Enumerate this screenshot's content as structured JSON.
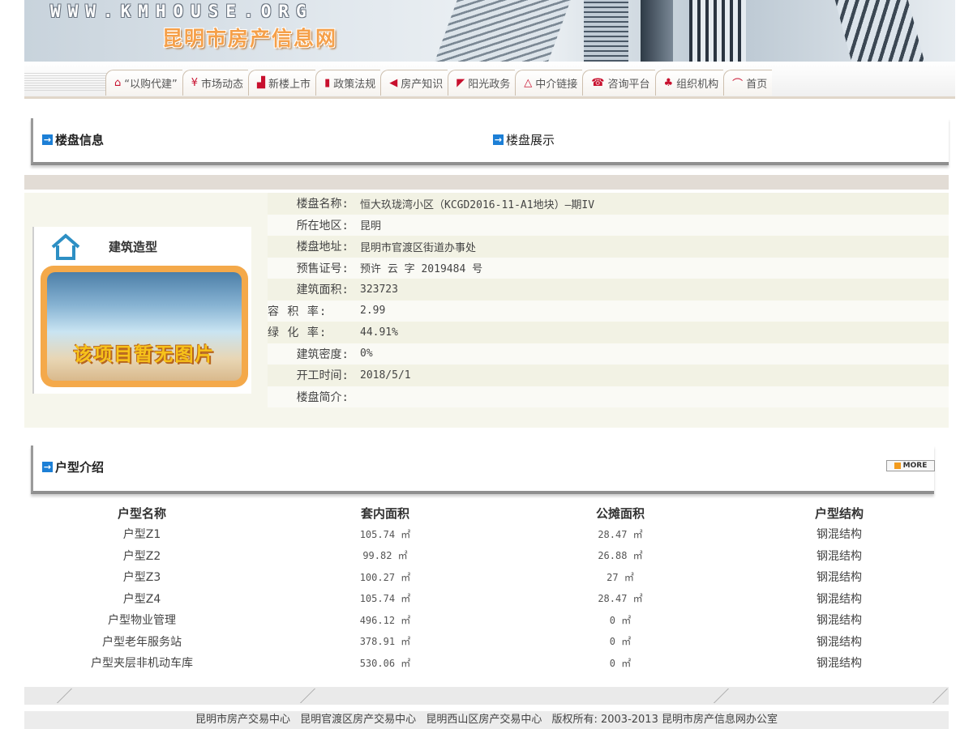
{
  "banner": {
    "url_text": "WWW.KMHOUSE.ORG",
    "site_name": "昆明市房产信息网"
  },
  "nav": {
    "items": [
      {
        "label": "“以购代建”",
        "icon": "house-hand-icon"
      },
      {
        "label": "市场动态",
        "icon": "yen-icon"
      },
      {
        "label": "新楼上市",
        "icon": "bar-chart-icon"
      },
      {
        "label": "政策法规",
        "icon": "book-icon"
      },
      {
        "label": "房产知识",
        "icon": "wing-icon"
      },
      {
        "label": "阳光政务",
        "icon": "flag-icon"
      },
      {
        "label": "中介链接",
        "icon": "triangle-icon"
      },
      {
        "label": "咨询平台",
        "icon": "phone-icon"
      },
      {
        "label": "组织机构",
        "icon": "people-icon"
      },
      {
        "label": "首页",
        "icon": "home-arc-icon"
      }
    ]
  },
  "sections": {
    "building_info": "楼盘信息",
    "building_show": "楼盘展示",
    "unit_intro": "户型介绍",
    "more": "MORE"
  },
  "type_box": {
    "title": "建筑造型",
    "no_image_caption": "该项目暂无图片"
  },
  "building": {
    "rows": [
      {
        "label": "楼盘名称:",
        "value": "恒大玖珑湾小区（KCGD2016-11-A1地块）—期IV"
      },
      {
        "label": "所在地区:",
        "value": "昆明"
      },
      {
        "label": "楼盘地址:",
        "value": "昆明市官渡区街道办事处"
      },
      {
        "label": "预售证号:",
        "value": "预许 云 字 2019484 号"
      },
      {
        "label": "建筑面积:",
        "value": "323723"
      },
      {
        "label": "容 积 率:",
        "value": "2.99"
      },
      {
        "label": "绿 化 率:",
        "value": "44.91%"
      },
      {
        "label": "建筑密度:",
        "value": "0%"
      },
      {
        "label": "开工时间:",
        "value": "2018/5/1"
      },
      {
        "label": "楼盘简介:",
        "value": ""
      }
    ]
  },
  "units": {
    "headers": [
      "户型名称",
      "套内面积",
      "公摊面积",
      "户型结构"
    ],
    "rows": [
      [
        "户型Z1",
        "105.74 ㎡",
        "28.47 ㎡",
        "钢混结构"
      ],
      [
        "户型Z2",
        "99.82 ㎡",
        "26.88 ㎡",
        "钢混结构"
      ],
      [
        "户型Z3",
        "100.27 ㎡",
        "27 ㎡",
        "钢混结构"
      ],
      [
        "户型Z4",
        "105.74 ㎡",
        "28.47 ㎡",
        "钢混结构"
      ],
      [
        "户型物业管理",
        "496.12 ㎡",
        "0 ㎡",
        "钢混结构"
      ],
      [
        "户型老年服务站",
        "378.91 ㎡",
        "0 ㎡",
        "钢混结构"
      ],
      [
        "户型夹层非机动车库",
        "530.06 ㎡",
        "0 ㎡",
        "钢混结构"
      ]
    ]
  },
  "footer": {
    "links": [
      "昆明市房产交易中心",
      "昆明官渡区房产交易中心",
      "昆明西山区房产交易中心"
    ],
    "copyright": "版权所有: 2003-2013 昆明市房产信息网办公室"
  }
}
